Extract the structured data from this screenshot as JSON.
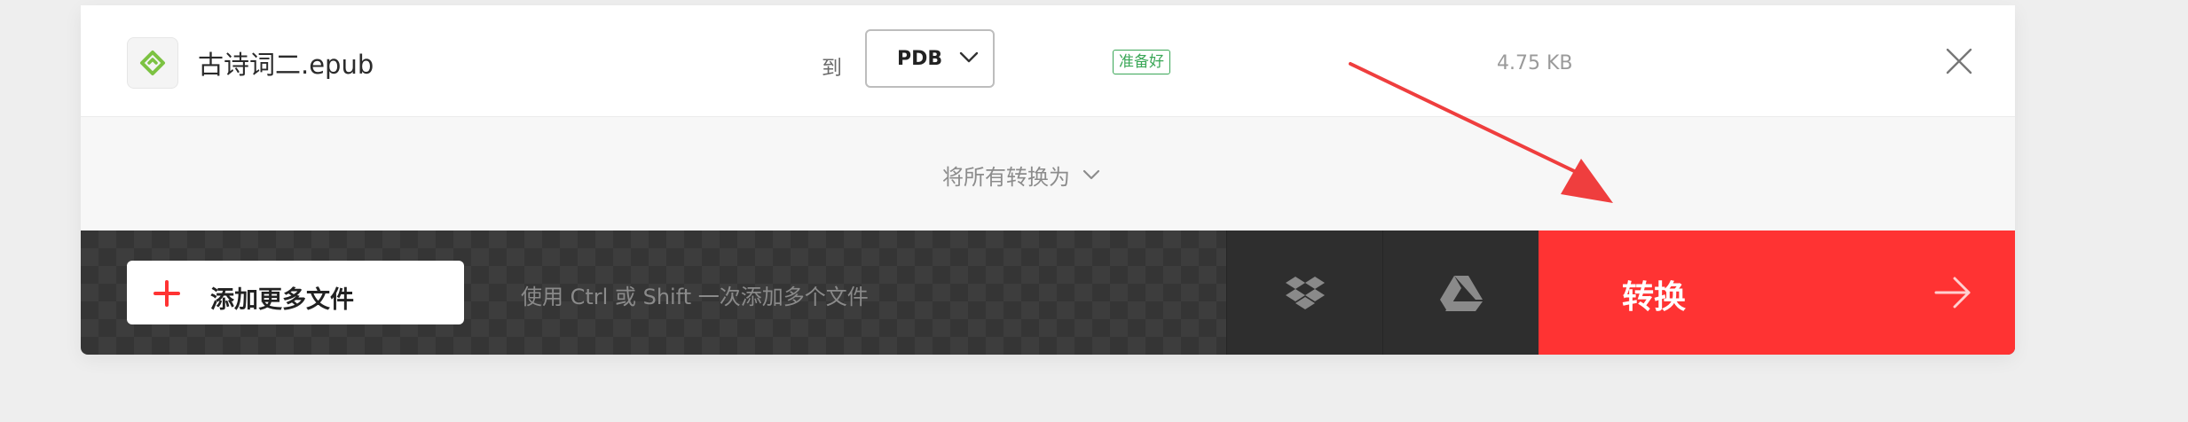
{
  "file": {
    "name": "古诗词二.epub",
    "to_label": "到",
    "target_format": "PDB",
    "status": "准备好",
    "size": "4.75 KB"
  },
  "convert_all": {
    "label": "将所有转换为"
  },
  "bottom_bar": {
    "add_files_label": "添加更多文件",
    "hint": "使用 Ctrl 或 Shift 一次添加多个文件",
    "convert_label": "转换"
  },
  "colors": {
    "accent_red": "#ff3333",
    "status_green": "#3aa757",
    "annotation_arrow": "#ef3e3e"
  },
  "icons": {
    "file": "epub-file-icon",
    "dropdown": "chevron-down-icon",
    "close": "close-icon",
    "add": "plus-icon",
    "dropbox": "dropbox-icon",
    "gdrive": "google-drive-icon",
    "convert": "arrow-right-icon"
  }
}
